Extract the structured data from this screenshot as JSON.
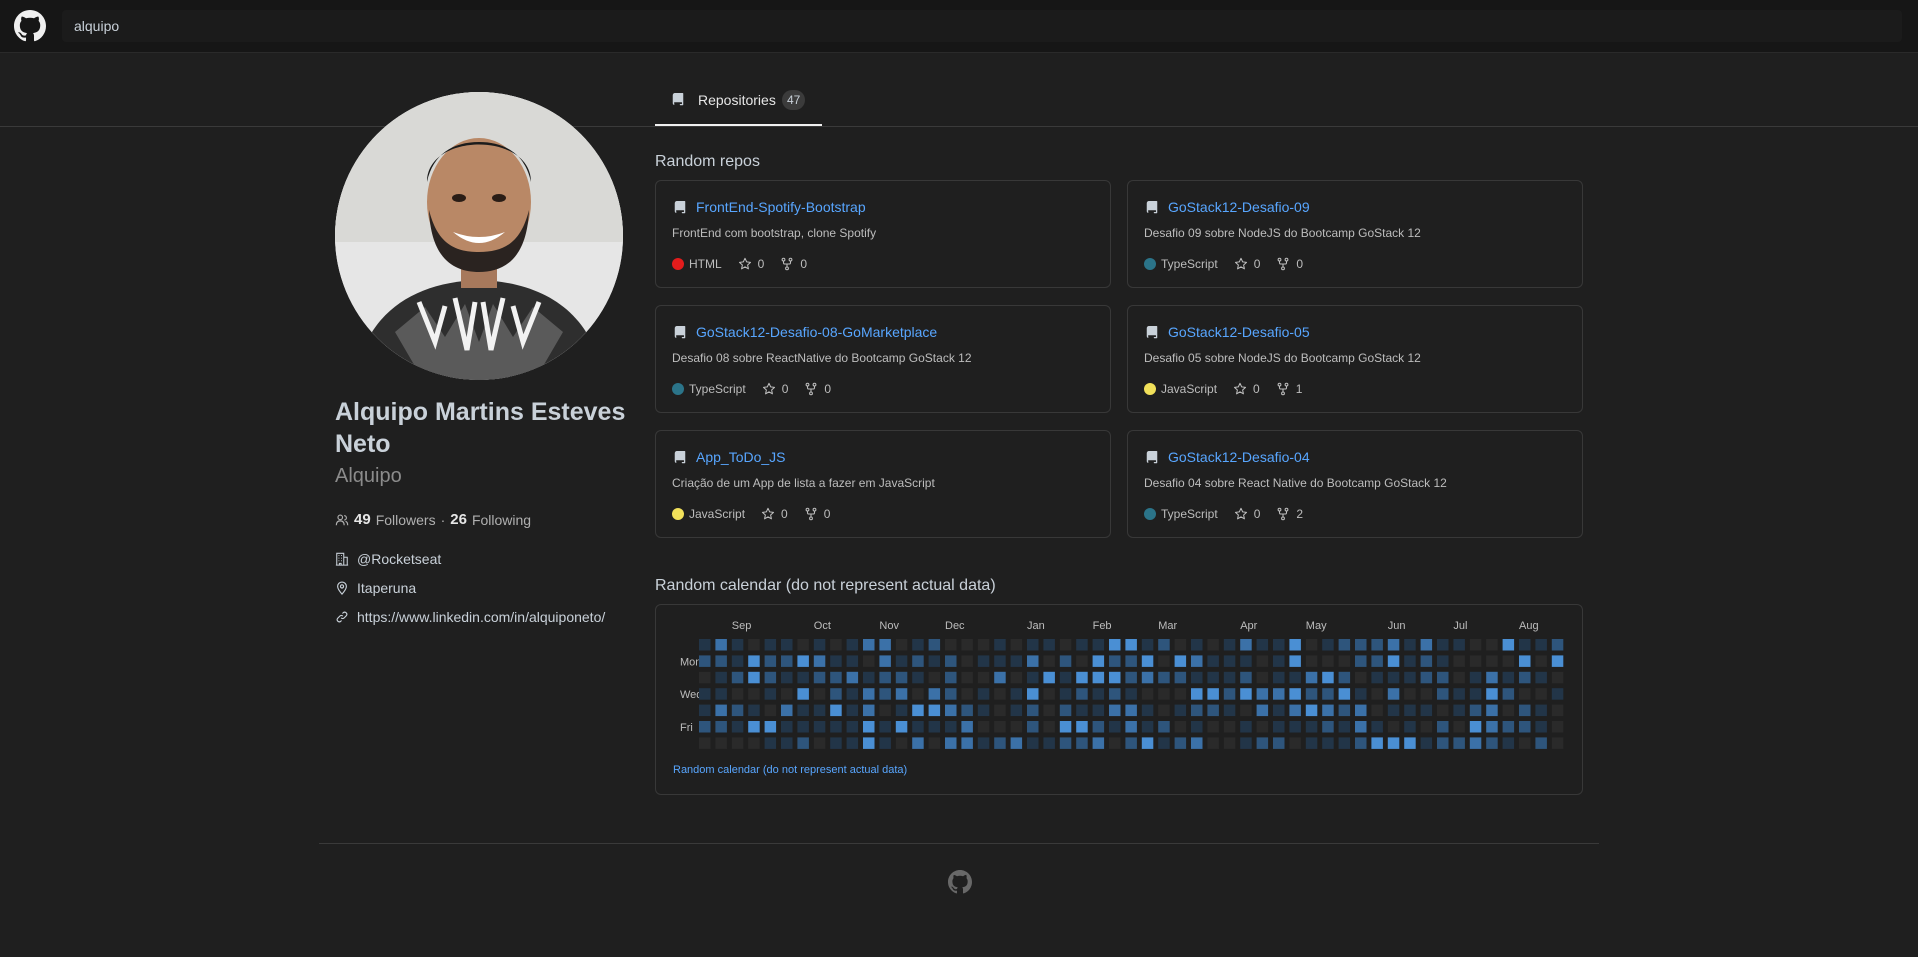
{
  "header": {
    "search_value": "alquipo"
  },
  "tabs": [
    {
      "label": "Repositories",
      "count": "47"
    }
  ],
  "profile": {
    "full_name": "Alquipo Martins Esteves Neto",
    "login": "Alquipo",
    "followers": "49",
    "followers_label": "Followers",
    "separator": "·",
    "following": "26",
    "following_label": "Following",
    "company": "@Rocketseat",
    "location": "Itaperuna",
    "website": "https://www.linkedin.com/in/alquiponeto/"
  },
  "repos_section": {
    "title": "Random repos"
  },
  "repos": [
    {
      "name": "FrontEnd-Spotify-Bootstrap",
      "description": "FrontEnd com bootstrap, clone Spotify",
      "language": "HTML",
      "language_color": "#e31c1c",
      "stars": "0",
      "forks": "0"
    },
    {
      "name": "GoStack12-Desafio-09",
      "description": "Desafio 09 sobre NodeJS do Bootcamp GoStack 12",
      "language": "TypeScript",
      "language_color": "#2b7489",
      "stars": "0",
      "forks": "0"
    },
    {
      "name": "GoStack12-Desafio-08-GoMarketplace",
      "description": "Desafio 08 sobre ReactNative do Bootcamp GoStack 12",
      "language": "TypeScript",
      "language_color": "#2b7489",
      "stars": "0",
      "forks": "0"
    },
    {
      "name": "GoStack12-Desafio-05",
      "description": "Desafio 05 sobre NodeJS do Bootcamp GoStack 12",
      "language": "JavaScript",
      "language_color": "#f1e05a",
      "stars": "0",
      "forks": "1"
    },
    {
      "name": "App_ToDo_JS",
      "description": "Criação de um App de lista a fazer em JavaScript",
      "language": "JavaScript",
      "language_color": "#f1e05a",
      "stars": "0",
      "forks": "0"
    },
    {
      "name": "GoStack12-Desafio-04",
      "description": "Desafio 04 sobre React Native do Bootcamp GoStack 12",
      "language": "TypeScript",
      "language_color": "#2b7489",
      "stars": "0",
      "forks": "2"
    }
  ],
  "calendar": {
    "title": "Random calendar (do not represent actual data)",
    "months": [
      "Sep",
      "Oct",
      "Nov",
      "Dec",
      "Jan",
      "Feb",
      "Mar",
      "Apr",
      "May",
      "Jun",
      "Jul",
      "Aug"
    ],
    "day_labels": [
      "Mon",
      "Wed",
      "Fri"
    ],
    "footer_link": "Random calendar (do not represent actual data)",
    "colors": [
      "#2a2a2a",
      "#223548",
      "#2e557c",
      "#3b71a8",
      "#4a8fd4"
    ]
  }
}
